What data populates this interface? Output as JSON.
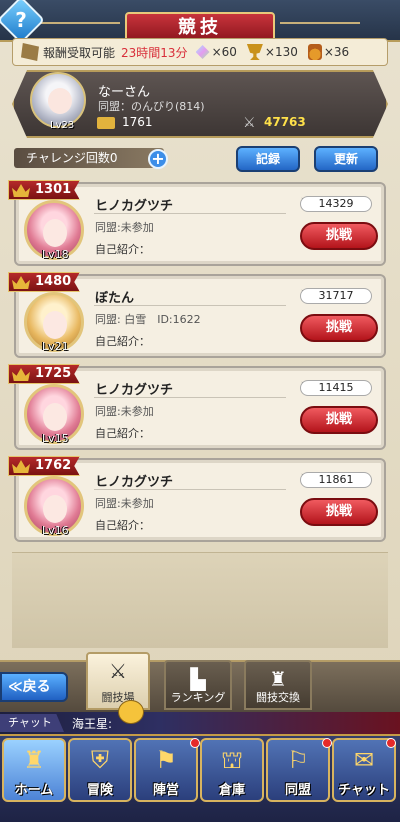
{
  "header": {
    "title": "競技",
    "help_label": "?"
  },
  "reward": {
    "label": "報酬受取可能",
    "timer": "23時間13分",
    "crystal": "×60",
    "trophy": "×130",
    "medal": "×36"
  },
  "player": {
    "name": "なーさん",
    "alliance": "同盟：のんびり(814)",
    "level": "Lv23",
    "gold": "1761",
    "power": "47763"
  },
  "challenge": {
    "label": "チャレンジ回数0",
    "plus": "+",
    "record_label": "記録",
    "refresh_label": "更新"
  },
  "opponents": [
    {
      "rank": "1301",
      "name": "ヒノカグツチ",
      "alliance": "同盟:未参加",
      "intro": "自己紹介：",
      "level": "Lv18",
      "power": "14329",
      "fight": "挑戦"
    },
    {
      "rank": "1480",
      "name": "ぼたん",
      "alliance": "同盟: 白雪　ID:1622",
      "intro": "自己紹介：",
      "level": "Lv21",
      "power": "31717",
      "fight": "挑戦"
    },
    {
      "rank": "1725",
      "name": "ヒノカグツチ",
      "alliance": "同盟:未参加",
      "intro": "自己紹介：",
      "level": "Lv15",
      "power": "11415",
      "fight": "挑戦"
    },
    {
      "rank": "1762",
      "name": "ヒノカグツチ",
      "alliance": "同盟:未参加",
      "intro": "自己紹介：",
      "level": "Lv16",
      "power": "11861",
      "fight": "挑戦"
    }
  ],
  "tabs": {
    "back": "≪戻る",
    "arena": "闘技場",
    "ranking": "ランキング",
    "exchange": "闘技交換"
  },
  "chat": {
    "tag": "チャット",
    "message": "海王星:"
  },
  "nav": {
    "home": "ホーム",
    "adventure": "冒険",
    "camp": "陣営",
    "storage": "倉庫",
    "alliance": "同盟",
    "chat": "チャット"
  }
}
